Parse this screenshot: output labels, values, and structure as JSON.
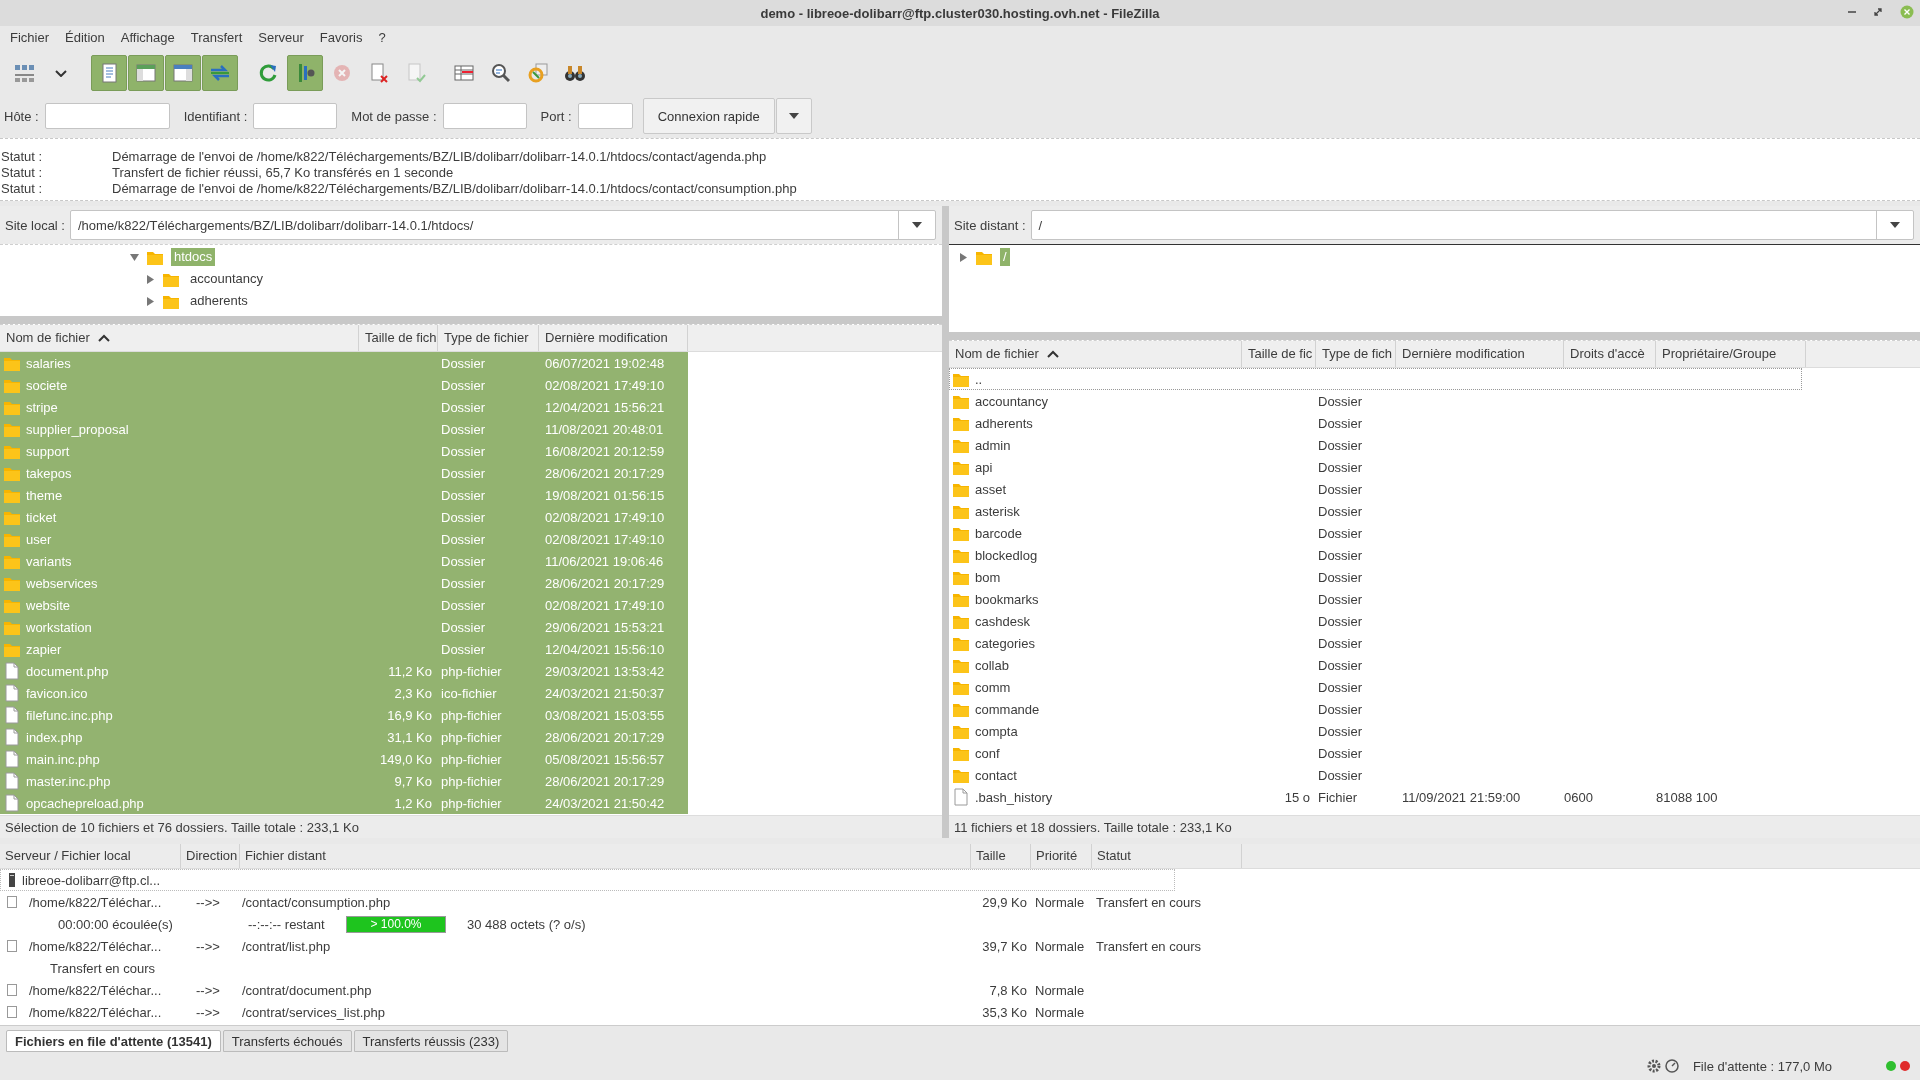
{
  "window": {
    "title": "demo - libreoe-dolibarr@ftp.cluster030.hosting.ovh.net - FileZilla"
  },
  "menu": [
    "Fichier",
    "Édition",
    "Affichage",
    "Transfert",
    "Serveur",
    "Favoris",
    "?"
  ],
  "toolbar": [
    [
      {
        "kind": "sitemanager",
        "on": false,
        "disabled": false
      },
      {
        "kind": "dropdown",
        "on": false,
        "disabled": false
      }
    ],
    [
      {
        "kind": "log",
        "on": true,
        "disabled": false
      },
      {
        "kind": "localtree",
        "on": true,
        "disabled": false
      },
      {
        "kind": "remotetree",
        "on": true,
        "disabled": false
      },
      {
        "kind": "queue",
        "on": true,
        "disabled": false
      }
    ],
    [
      {
        "kind": "refresh",
        "on": false,
        "disabled": false
      },
      {
        "kind": "process",
        "on": true,
        "disabled": false
      },
      {
        "kind": "cancel",
        "on": false,
        "disabled": true
      },
      {
        "kind": "disconnect",
        "on": false,
        "disabled": false
      },
      {
        "kind": "reconnect",
        "on": false,
        "disabled": true
      }
    ],
    [
      {
        "kind": "filter",
        "on": false,
        "disabled": false
      },
      {
        "kind": "compare",
        "on": false,
        "disabled": false
      },
      {
        "kind": "sync",
        "on": false,
        "disabled": false
      },
      {
        "kind": "search",
        "on": false,
        "disabled": false
      }
    ]
  ],
  "quickconnect": {
    "fields": [
      {
        "label": "Hôte :"
      },
      {
        "label": "Identifiant :"
      },
      {
        "label": "Mot de passe :"
      },
      {
        "label": "Port :"
      }
    ],
    "button": "Connexion rapide"
  },
  "log": [
    {
      "label": "Statut :",
      "text": "Démarrage de l'envoi de /home/k822/Téléchargements/BZ/LIB/dolibarr/dolibarr-14.0.1/htdocs/contact/agenda.php"
    },
    {
      "label": "Statut :",
      "text": "Transfert de fichier réussi, 65,7 Ko transférés en 1 seconde"
    },
    {
      "label": "Statut :",
      "text": "Démarrage de l'envoi de /home/k822/Téléchargements/BZ/LIB/dolibarr/dolibarr-14.0.1/htdocs/contact/consumption.php"
    }
  ],
  "local": {
    "site_label": "Site local :",
    "path": "/home/k822/Téléchargements/BZ/LIB/dolibarr/dolibarr-14.0.1/htdocs/",
    "tree": [
      {
        "name": "htdocs",
        "expanded": true,
        "selected": true,
        "children": [
          {
            "name": "accountancy",
            "expanded": false,
            "selected": false
          },
          {
            "name": "adherents",
            "expanded": false,
            "selected": false
          }
        ]
      }
    ],
    "columns": [
      "Nom de fichier",
      "Taille de fich",
      "Type de fichier",
      "Dernière modification"
    ],
    "rows": [
      {
        "kind": "folder",
        "name": "salaries",
        "size": "",
        "type": "Dossier",
        "modified": "06/07/2021 19:02:48",
        "selected": true
      },
      {
        "kind": "folder",
        "name": "societe",
        "type": "Dossier",
        "modified": "02/08/2021 17:49:10",
        "selected": true
      },
      {
        "kind": "folder",
        "name": "stripe",
        "type": "Dossier",
        "modified": "12/04/2021 15:56:21",
        "selected": true
      },
      {
        "kind": "folder",
        "name": "supplier_proposal",
        "type": "Dossier",
        "modified": "11/08/2021 20:48:01",
        "selected": true
      },
      {
        "kind": "folder",
        "name": "support",
        "type": "Dossier",
        "modified": "16/08/2021 20:12:59",
        "selected": true
      },
      {
        "kind": "folder",
        "name": "takepos",
        "type": "Dossier",
        "modified": "28/06/2021 20:17:29",
        "selected": true
      },
      {
        "kind": "folder",
        "name": "theme",
        "type": "Dossier",
        "modified": "19/08/2021 01:56:15",
        "selected": true
      },
      {
        "kind": "folder",
        "name": "ticket",
        "type": "Dossier",
        "modified": "02/08/2021 17:49:10",
        "selected": true
      },
      {
        "kind": "folder",
        "name": "user",
        "type": "Dossier",
        "modified": "02/08/2021 17:49:10",
        "selected": true
      },
      {
        "kind": "folder",
        "name": "variants",
        "type": "Dossier",
        "modified": "11/06/2021 19:06:46",
        "selected": true
      },
      {
        "kind": "folder",
        "name": "webservices",
        "type": "Dossier",
        "modified": "28/06/2021 20:17:29",
        "selected": true
      },
      {
        "kind": "folder",
        "name": "website",
        "type": "Dossier",
        "modified": "02/08/2021 17:49:10",
        "selected": true
      },
      {
        "kind": "folder",
        "name": "workstation",
        "type": "Dossier",
        "modified": "29/06/2021 15:53:21",
        "selected": true
      },
      {
        "kind": "folder",
        "name": "zapier",
        "type": "Dossier",
        "modified": "12/04/2021 15:56:10",
        "selected": true
      },
      {
        "kind": "file",
        "name": "document.php",
        "size": "11,2 Ko",
        "type": "php-fichier",
        "modified": "29/03/2021 13:53:42",
        "selected": true
      },
      {
        "kind": "file",
        "name": "favicon.ico",
        "size": "2,3 Ko",
        "type": "ico-fichier",
        "modified": "24/03/2021 21:50:37",
        "selected": true
      },
      {
        "kind": "file",
        "name": "filefunc.inc.php",
        "size": "16,9 Ko",
        "type": "php-fichier",
        "modified": "03/08/2021 15:03:55",
        "selected": true
      },
      {
        "kind": "file",
        "name": "index.php",
        "size": "31,1 Ko",
        "type": "php-fichier",
        "modified": "28/06/2021 20:17:29",
        "selected": true
      },
      {
        "kind": "file",
        "name": "main.inc.php",
        "size": "149,0 Ko",
        "type": "php-fichier",
        "modified": "05/08/2021 15:56:57",
        "selected": true
      },
      {
        "kind": "file",
        "name": "master.inc.php",
        "size": "9,7 Ko",
        "type": "php-fichier",
        "modified": "28/06/2021 20:17:29",
        "selected": true
      },
      {
        "kind": "file",
        "name": "opcachepreload.php",
        "size": "1,2 Ko",
        "type": "php-fichier",
        "modified": "24/03/2021 21:50:42",
        "selected": true
      }
    ],
    "status": "Sélection de 10 fichiers et 76 dossiers. Taille totale : 233,1 Ko"
  },
  "remote": {
    "site_label": "Site distant :",
    "path": "/",
    "tree": [
      {
        "name": "/",
        "expanded": false,
        "selected": true
      }
    ],
    "columns": [
      "Nom de fichier",
      "Taille de fic",
      "Type de fich",
      "Dernière modification",
      "Droits d'accè",
      "Propriétaire/Groupe"
    ],
    "rows": [
      {
        "kind": "folder",
        "name": "..",
        "focused": true,
        "selected": false
      },
      {
        "kind": "folder",
        "name": "accountancy",
        "type": "Dossier",
        "focused": false,
        "selected": false
      },
      {
        "kind": "folder",
        "name": "adherents",
        "type": "Dossier",
        "focused": false,
        "selected": false
      },
      {
        "kind": "folder",
        "name": "admin",
        "type": "Dossier",
        "focused": false,
        "selected": false
      },
      {
        "kind": "folder",
        "name": "api",
        "type": "Dossier",
        "focused": false,
        "selected": false
      },
      {
        "kind": "folder",
        "name": "asset",
        "type": "Dossier",
        "focused": false,
        "selected": false
      },
      {
        "kind": "folder",
        "name": "asterisk",
        "type": "Dossier",
        "focused": false,
        "selected": false
      },
      {
        "kind": "folder",
        "name": "barcode",
        "type": "Dossier",
        "focused": false,
        "selected": false
      },
      {
        "kind": "folder",
        "name": "blockedlog",
        "type": "Dossier",
        "focused": false,
        "selected": false
      },
      {
        "kind": "folder",
        "name": "bom",
        "type": "Dossier",
        "focused": false,
        "selected": false
      },
      {
        "kind": "folder",
        "name": "bookmarks",
        "type": "Dossier",
        "focused": false,
        "selected": false
      },
      {
        "kind": "folder",
        "name": "cashdesk",
        "type": "Dossier",
        "focused": false,
        "selected": false
      },
      {
        "kind": "folder",
        "name": "categories",
        "type": "Dossier",
        "focused": false,
        "selected": false
      },
      {
        "kind": "folder",
        "name": "collab",
        "type": "Dossier",
        "focused": false,
        "selected": false
      },
      {
        "kind": "folder",
        "name": "comm",
        "type": "Dossier",
        "focused": false,
        "selected": false
      },
      {
        "kind": "folder",
        "name": "commande",
        "type": "Dossier",
        "focused": false,
        "selected": false
      },
      {
        "kind": "folder",
        "name": "compta",
        "type": "Dossier",
        "focused": false,
        "selected": false
      },
      {
        "kind": "folder",
        "name": "conf",
        "type": "Dossier",
        "focused": false,
        "selected": false
      },
      {
        "kind": "folder",
        "name": "contact",
        "type": "Dossier",
        "focused": false,
        "selected": false
      },
      {
        "kind": "file",
        "name": ".bash_history",
        "size": "15 o",
        "type": "Fichier",
        "modified": "11/09/2021 21:59:00",
        "rights": "0600",
        "owner": "81088 100",
        "focused": false,
        "selected": false
      }
    ],
    "status": "11 fichiers et 18 dossiers. Taille totale : 233,1 Ko"
  },
  "queue": {
    "columns": [
      "Serveur / Fichier local",
      "Direction",
      "Fichier distant",
      "Taille",
      "Priorité",
      "Statut"
    ],
    "rows": [
      {
        "kind": "server",
        "text": "libreoe-dolibarr@ftp.cl..."
      },
      {
        "kind": "file",
        "local": "/home/k822/Téléchar...",
        "direction": "-->>",
        "remote": "/contact/consumption.php",
        "size": "29,9 Ko",
        "priority": "Normale",
        "status": "Transfert en cours"
      },
      {
        "kind": "progress",
        "elapsed": "00:00:00 écoulée(s)",
        "remaining": "--:--:-- restant",
        "level": 1,
        "label": "> 100.0%",
        "bytes": "30 488 octets (? o/s)"
      },
      {
        "kind": "file",
        "local": "/home/k822/Téléchar...",
        "direction": "-->>",
        "remote": "/contrat/list.php",
        "size": "39,7 Ko",
        "priority": "Normale",
        "status": "Transfert en cours"
      },
      {
        "kind": "note",
        "text": "Transfert en cours"
      },
      {
        "kind": "file",
        "local": "/home/k822/Téléchar...",
        "direction": "-->>",
        "remote": "/contrat/document.php",
        "size": "7,8 Ko",
        "priority": "Normale"
      },
      {
        "kind": "file",
        "local": "/home/k822/Téléchar...",
        "direction": "-->>",
        "remote": "/contrat/services_list.php",
        "size": "35,3 Ko",
        "priority": "Normale"
      }
    ],
    "tabs": [
      {
        "label": "Fichiers en file d'attente (13541)",
        "selected": true
      },
      {
        "label": "Transferts échoués",
        "selected": false
      },
      {
        "label": "Transferts réussis (233)",
        "selected": false
      }
    ]
  },
  "status_bar": {
    "queue": "File d'attente : 177,0 Mo",
    "lights": [
      {
        "color": "#2fbf2f"
      },
      {
        "color": "#e02b2b"
      }
    ]
  }
}
